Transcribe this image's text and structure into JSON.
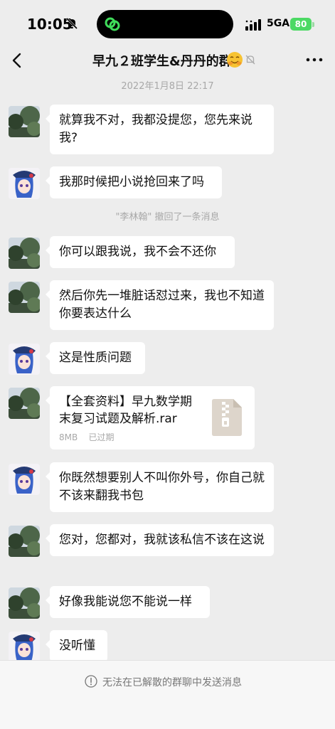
{
  "status": {
    "time": "10:05",
    "network": "5GA",
    "battery": "80"
  },
  "header": {
    "title": "早九２班学生&丹丹的群"
  },
  "timestamp": "2022年1月8日 22:17",
  "recall_notice": "\"李林翰\" 撤回了一条消息",
  "messages": [
    {
      "sender": "tree",
      "text": "就算我不对，我都没提您，您先来说我?"
    },
    {
      "sender": "anime",
      "text": "我那时候把小说抢回来了吗"
    },
    {
      "sender": "tree",
      "text": "你可以跟我说，我不会不还你"
    },
    {
      "sender": "tree",
      "text": "然后你先一堆脏话怼过来，我也不知道你要表达什么"
    },
    {
      "sender": "anime",
      "text": "这是性质问题"
    },
    {
      "sender": "tree",
      "type": "file",
      "title": "【全套资料】早九数学期末复习试题及解析.rar",
      "size": "8MB",
      "status": "已过期"
    },
    {
      "sender": "anime",
      "text": "你既然想要别人不叫你外号，你自己就不该来翻我书包"
    },
    {
      "sender": "tree",
      "text": "您对，您都对，我就该私信不该在这说"
    },
    {
      "sender": "tree",
      "text": "好像我能说您不能说一样"
    },
    {
      "sender": "anime",
      "text": "没听懂"
    }
  ],
  "footer": {
    "text": "无法在已解散的群聊中发送消息"
  },
  "colors": {
    "background": "#ededed",
    "bubble": "#ffffff",
    "battery": "#4cd964",
    "muted_text": "#a8a8a8"
  }
}
